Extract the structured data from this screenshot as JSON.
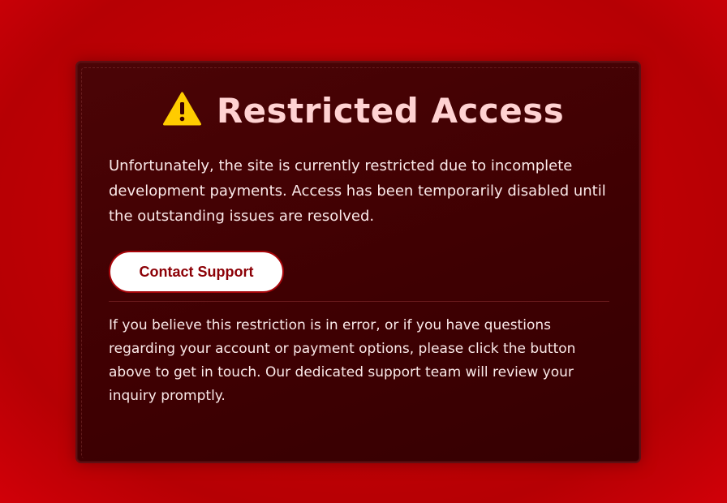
{
  "page": {
    "background_color": "#c40005",
    "card_color": "#400003",
    "title": "Restricted Access",
    "title_color": "#ffd2d2",
    "warning_icon": "warning-triangle-icon",
    "warning_icon_color": "#ffcc00",
    "message": "Unfortunately, the site is currently restricted due to incomplete development payments. Access has been temporarily disabled until the outstanding issues are resolved.",
    "contact_button_label": "Contact Support",
    "contact_button_text_color": "#8c0006",
    "help_text": "If you believe this restriction is in error, or if you have questions regarding your account or payment options, please click the button above to get in touch. Our dedicated support team will review your inquiry promptly."
  }
}
